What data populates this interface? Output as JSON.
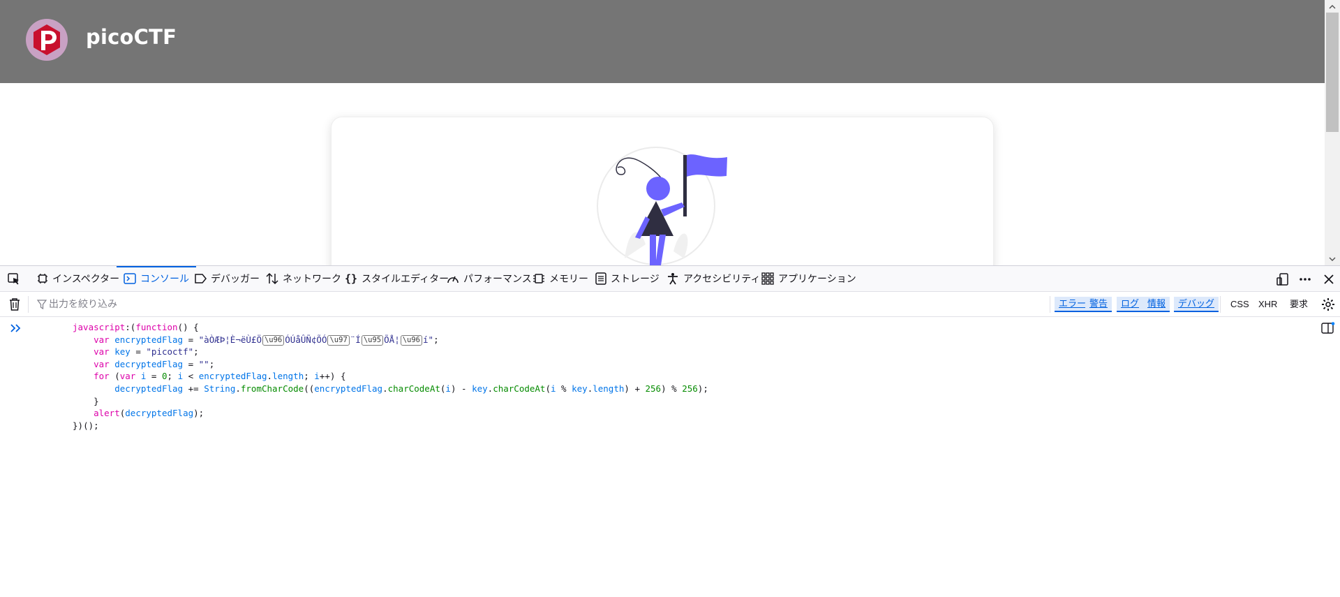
{
  "site": {
    "name": "picoCTF",
    "header_color": "#757575",
    "accent": "#6c63ff"
  },
  "devtools": {
    "tabs": [
      {
        "label": "インスペクター",
        "icon": "inspector-icon"
      },
      {
        "label": "コンソール",
        "icon": "console-icon",
        "selected": true
      },
      {
        "label": "デバッガー",
        "icon": "debugger-icon"
      },
      {
        "label": "ネットワーク",
        "icon": "network-icon"
      },
      {
        "label": "スタイルエディター",
        "icon": "style-editor-icon"
      },
      {
        "label": "パフォーマンス",
        "icon": "performance-icon"
      },
      {
        "label": "メモリー",
        "icon": "memory-icon"
      },
      {
        "label": "ストレージ",
        "icon": "storage-icon"
      },
      {
        "label": "アクセシビリティ",
        "icon": "accessibility-icon"
      },
      {
        "label": "アプリケーション",
        "icon": "application-icon"
      }
    ],
    "filter_placeholder": "出力を絞り込み",
    "levels": [
      "エラー",
      "警告",
      "ログ",
      "情報",
      "デバッグ"
    ],
    "net_filters": [
      "CSS",
      "XHR",
      "要求"
    ],
    "accent": "#0061e0"
  },
  "console": {
    "code_lines": [
      "javascript:(function() {",
      "    var encryptedFlag = \"àÒÆÞ¦È¬ëÙ£Ö\\u96ÓÚåÛÑ¢ÕÓ\\u97¨Í\\u95ÕÅ¦\\u96í\";",
      "    var key = \"picoctf\";",
      "    var decryptedFlag = \"\";",
      "    for (var i = 0; i < encryptedFlag.length; i++) {",
      "        decryptedFlag += String.fromCharCode((encryptedFlag.charCodeAt(i) - key.charCodeAt(i % key.length) + 256) % 256);",
      "    }",
      "    alert(decryptedFlag);",
      "})();"
    ]
  }
}
